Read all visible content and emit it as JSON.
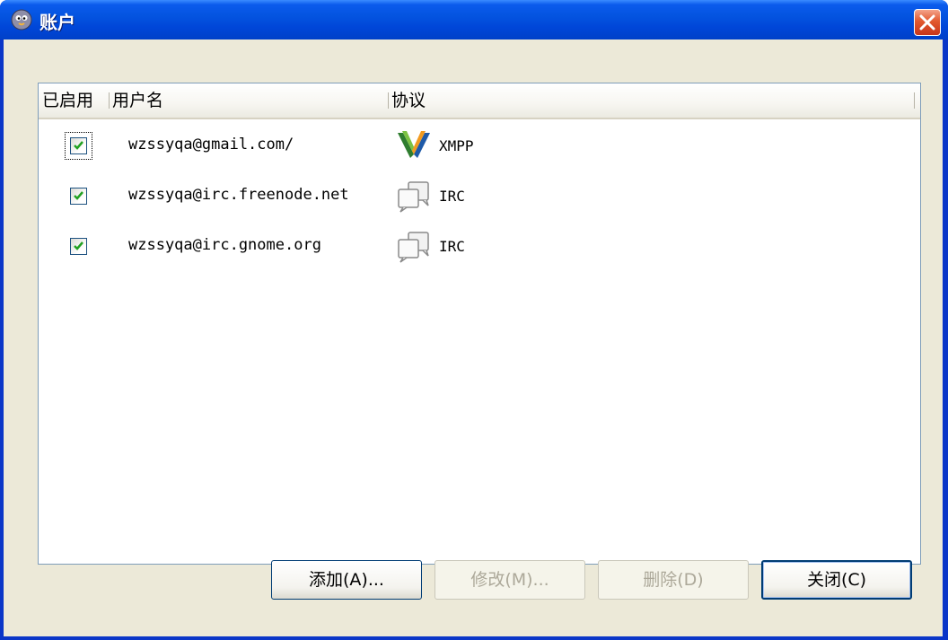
{
  "window": {
    "title": "账户"
  },
  "columns": {
    "enabled": "已启用",
    "username": "用户名",
    "protocol": "协议"
  },
  "accounts": [
    {
      "enabled": true,
      "username": "wzssyqa@gmail.com/",
      "protocol": "XMPP",
      "icon": "xmpp-icon"
    },
    {
      "enabled": true,
      "username": "wzssyqa@irc.freenode.net",
      "protocol": "IRC",
      "icon": "chat-bubbles-icon"
    },
    {
      "enabled": true,
      "username": "wzssyqa@irc.gnome.org",
      "protocol": "IRC",
      "icon": "chat-bubbles-icon"
    }
  ],
  "buttons": {
    "add": "添加(A)...",
    "modify": "修改(M)...",
    "delete": "删除(D)",
    "close": "关闭(C)"
  },
  "colors": {
    "titlebar": "#0454e0",
    "dialog_bg": "#ece9d8",
    "checkmark": "#21a121",
    "close_button": "#e2582e"
  }
}
